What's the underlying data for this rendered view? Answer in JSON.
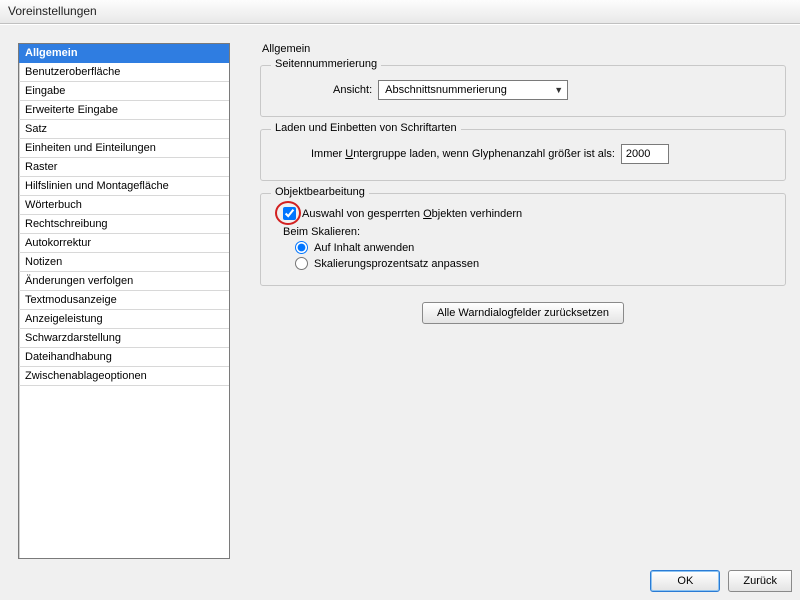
{
  "window": {
    "title": "Voreinstellungen"
  },
  "sidebar": {
    "items": [
      "Allgemein",
      "Benutzeroberfläche",
      "Eingabe",
      "Erweiterte Eingabe",
      "Satz",
      "Einheiten und Einteilungen",
      "Raster",
      "Hilfslinien und Montagefläche",
      "Wörterbuch",
      "Rechtschreibung",
      "Autokorrektur",
      "Notizen",
      "Änderungen verfolgen",
      "Textmodusanzeige",
      "Anzeigeleistung",
      "Schwarzdarstellung",
      "Dateihandhabung",
      "Zwischenablageoptionen"
    ],
    "selected_index": 0
  },
  "page": {
    "title": "Allgemein",
    "group_pagination": {
      "title": "Seitennummerierung",
      "view_label": "Ansicht:",
      "view_value": "Abschnittsnummerierung"
    },
    "group_fonts": {
      "title": "Laden und Einbetten von Schriftarten",
      "subset_prefix": "Immer ",
      "subset_underlined": "U",
      "subset_mid": "ntergruppe laden, wenn Glyphenanzahl größer ist als:",
      "subset_value": "2000"
    },
    "group_object": {
      "title": "Objektbearbeitung",
      "cb_prevent_prefix": "Auswahl von gesperrten ",
      "cb_prevent_underlined": "O",
      "cb_prevent_suffix": "bjekten verhindern",
      "cb_prevent_checked": true,
      "scaling_label": "Beim Skalieren:",
      "radio_content": "Auf Inhalt anwenden",
      "radio_percent": "Skalierungsprozentsatz anpassen",
      "radio_selected": "content"
    },
    "reset_button": "Alle Warndialogfelder zurücksetzen"
  },
  "footer": {
    "ok": "OK",
    "back": "Zurück"
  }
}
